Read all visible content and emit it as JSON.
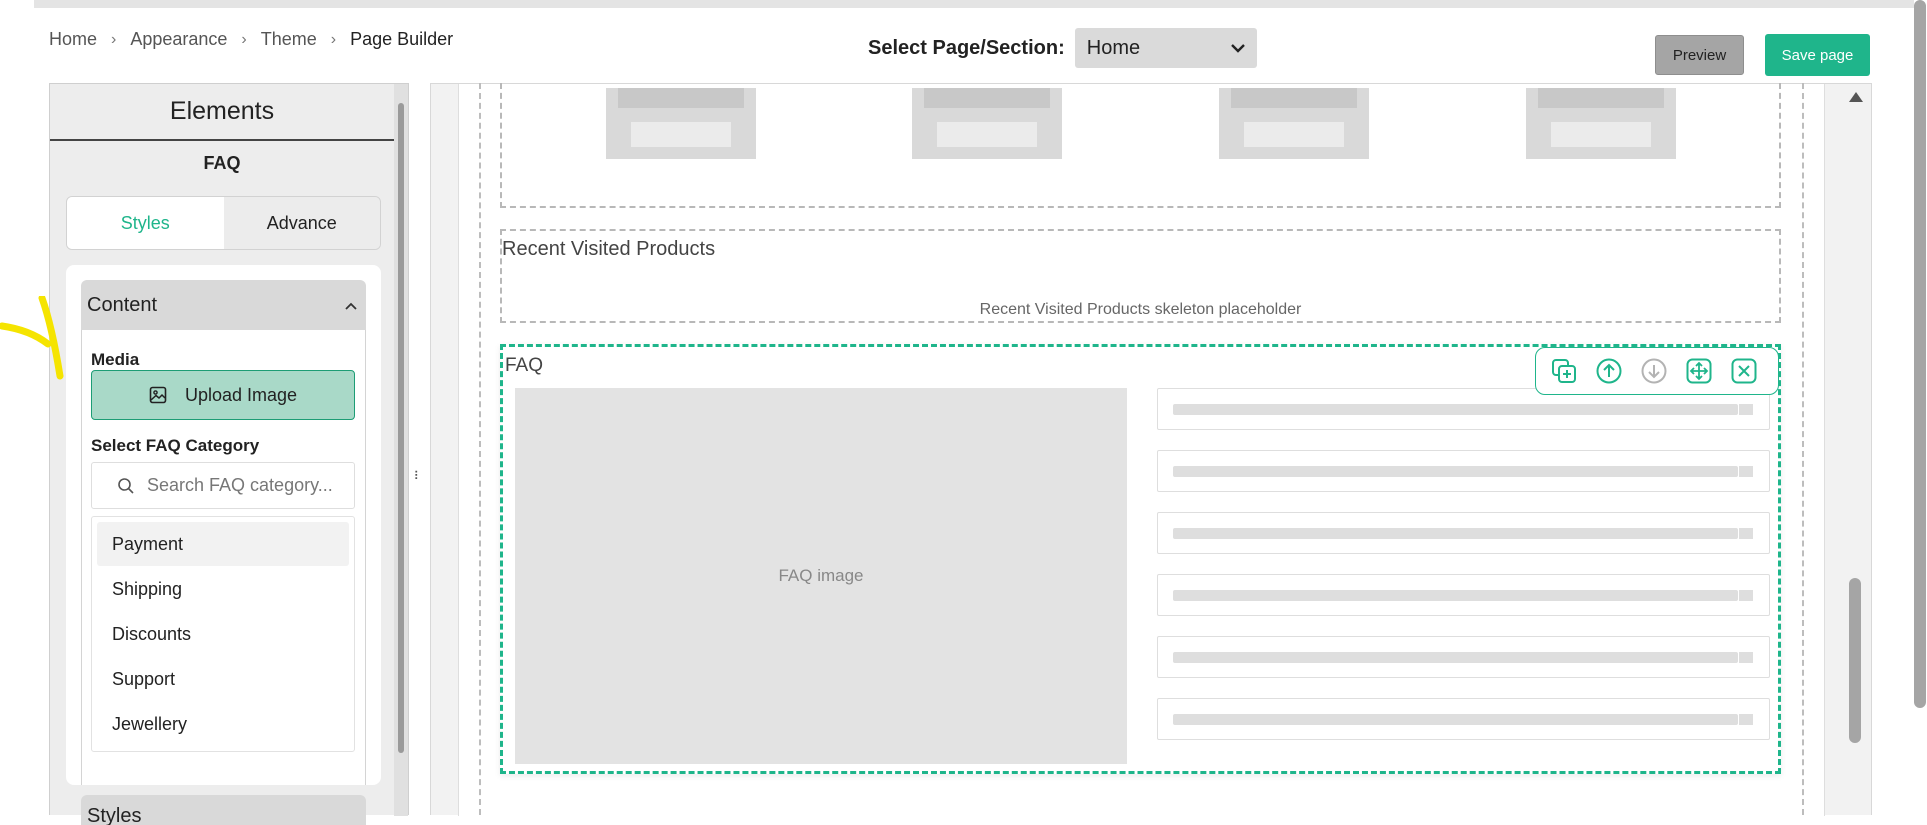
{
  "breadcrumb": {
    "items": [
      "Home",
      "Appearance",
      "Theme",
      "Page Builder"
    ]
  },
  "page_select": {
    "label": "Select Page/Section:",
    "value": "Home"
  },
  "actions": {
    "preview": "Preview",
    "save": "Save page"
  },
  "elements_panel": {
    "title": "Elements",
    "subtitle": "FAQ",
    "tabs": [
      "Styles",
      "Advance"
    ],
    "active_tab": "Styles",
    "content_section": {
      "title": "Content",
      "media_label": "Media",
      "upload_label": "Upload Image",
      "category_label": "Select FAQ Category",
      "search_placeholder": "Search FAQ category...",
      "categories": [
        "Payment",
        "Shipping",
        "Discounts",
        "Support",
        "Jewellery"
      ],
      "selected_category": "Payment"
    },
    "next_section_title": "Styles"
  },
  "canvas": {
    "recent_title": "Recent Visited Products",
    "recent_placeholder": "Recent Visited Products skeleton placeholder",
    "faq_title": "FAQ",
    "faq_image_label": "FAQ image",
    "faq_rows": 6,
    "toolbar_icons": [
      "duplicate-icon",
      "move-up-icon",
      "move-down-icon",
      "drag-move-icon",
      "remove-icon"
    ]
  },
  "colors": {
    "accent": "#1fb58b",
    "upload_bg": "#a9d9c8",
    "preview_bg": "#a5a5a5"
  }
}
